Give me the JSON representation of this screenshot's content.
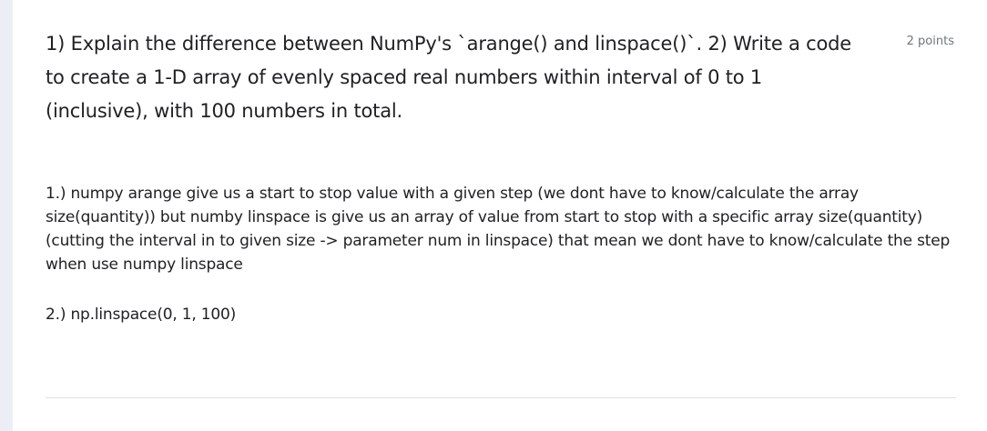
{
  "question": {
    "title": "1) Explain the difference between NumPy's `arange() and linspace()`. 2) Write a code to create a 1-D array of evenly spaced real numbers within interval of 0 to 1 (inclusive), with 100 numbers in total.",
    "points": "2 points"
  },
  "answer": {
    "paragraph_1": "1.) numpy arange give us a start to stop value with a given step (we dont have to know/calculate the array size(quantity)) but numby linspace is give us an array of value from start to stop with a specific array size(quantity) (cutting the interval in to given size -> parameter num in linspace) that mean we dont have to know/calculate the step when use numpy linspace",
    "paragraph_2": "2.) np.linspace(0, 1, 100)"
  }
}
